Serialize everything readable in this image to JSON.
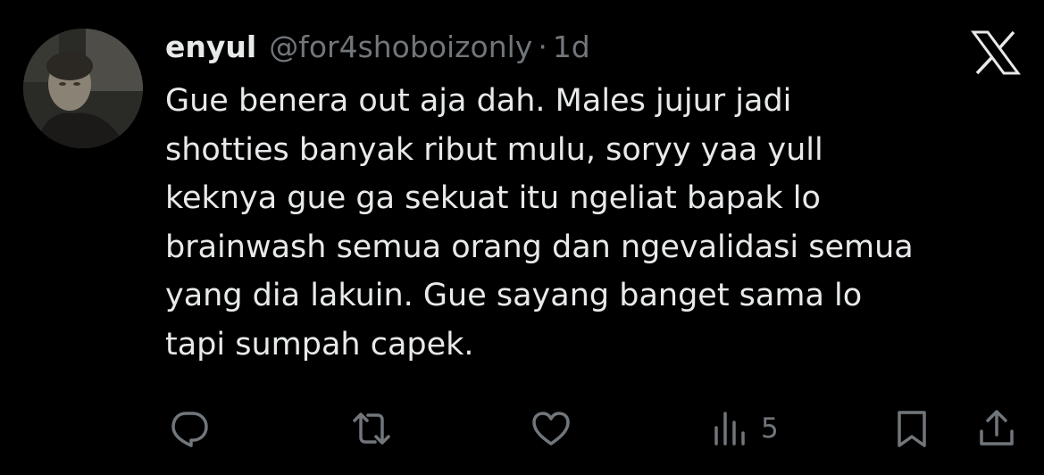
{
  "tweet": {
    "author": {
      "display_name": "enyul",
      "handle": "@for4shoboizonly",
      "avatar_icon": "user-avatar"
    },
    "separator": "·",
    "timestamp": "1d",
    "platform_icon": "x-logo-icon",
    "text": "Gue benera out aja dah. Males jujur jadi\nshotties banyak ribut mulu, soryy yaa yull\nkeknya gue ga sekuat itu ngeliat bapak lo\nbrainwash semua orang dan ngevalidasi semua\nyang dia lakuin.  Gue sayang banget sama lo\ntapi sumpah capek.",
    "actions": {
      "reply_icon": "reply-icon",
      "retweet_icon": "retweet-icon",
      "like_icon": "like-icon",
      "views_icon": "views-icon",
      "views_count": "5",
      "bookmark_icon": "bookmark-icon",
      "share_icon": "share-icon"
    }
  },
  "colors": {
    "background": "#000000",
    "primary_text": "#e7e9ea",
    "secondary_text": "#71767b"
  }
}
